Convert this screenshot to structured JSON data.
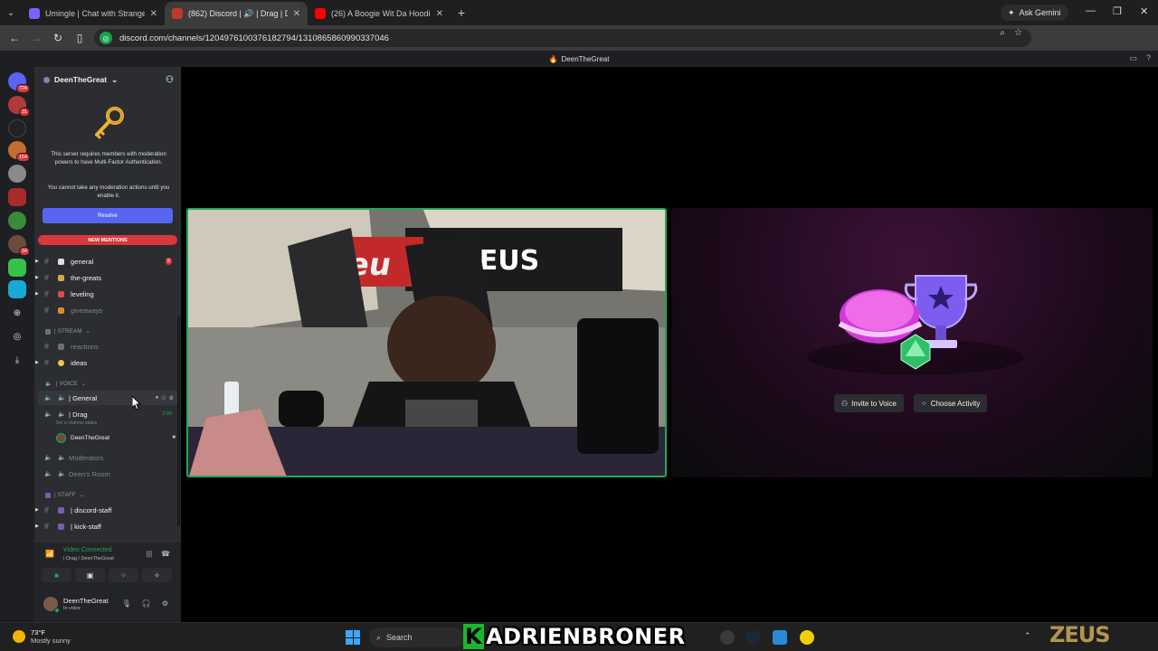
{
  "browser": {
    "tabs": [
      {
        "title": "Umingle | Chat with Strangers N",
        "color": "#5865f2",
        "active": false
      },
      {
        "title": "(862) Discord | 🔊 | Drag | D",
        "color": "#c0392b",
        "active": true
      },
      {
        "title": "(26) A Boogie Wit Da Hoodie -",
        "color": "#ff0000",
        "active": false
      }
    ],
    "ask_gemini": "Ask Gemini",
    "url": "discord.com/channels/1204976100376182794/1310865860990337046"
  },
  "discord": {
    "window_title": "DeenTheGreat",
    "server_name": "DeenTheGreat",
    "rail_badges": [
      "724",
      "31",
      "154",
      "34"
    ],
    "mfa": {
      "line1": "This server requires members with moderation powers to have Multi-Factor Authentication.",
      "line2": "You cannot take any moderation actions until you enable it.",
      "resolve": "Resolve"
    },
    "new_mentions": "NEW MENTIONS",
    "channels_top": [
      {
        "name": "general",
        "count": "5",
        "muted": false,
        "emoji_color": "#e0e0e0"
      },
      {
        "name": "the-greats",
        "muted": false,
        "emoji_color": "#d9a54a"
      },
      {
        "name": "leveling",
        "muted": false,
        "emoji_color": "#e04848"
      },
      {
        "name": "giveaways",
        "muted": true,
        "emoji_color": "#e08a2b"
      }
    ],
    "cat_stream": "| STREAM",
    "stream_channels": [
      {
        "name": "reactions",
        "muted": true,
        "emoji_color": "#6d6f78"
      },
      {
        "name": "ideas",
        "muted": false,
        "emoji_color": "#f5c542"
      }
    ],
    "cat_voice": "| VOICE",
    "voice_channels": [
      {
        "name": "| General",
        "muted": false
      },
      {
        "name": "| Drag",
        "muted": false,
        "time": "2:09"
      }
    ],
    "set_status": "Set a channel status",
    "member": "DeenTheGreat",
    "voice_channels_2": [
      {
        "name": "Moderators"
      },
      {
        "name": "Deen's Room"
      }
    ],
    "cat_staff": "| STAFF",
    "staff_channels": [
      {
        "name": "| discord-staff"
      },
      {
        "name": "| kick-staff"
      }
    ],
    "voice_panel": {
      "status": "Video Connected",
      "channel": "| Drag / DeenTheGreat"
    },
    "user": {
      "name": "DeenTheGreat",
      "status": "In voice"
    },
    "activity": {
      "invite": "Invite to Voice",
      "choose": "Choose Activity"
    }
  },
  "taskbar": {
    "temp": "73°F",
    "weather": "Mostly sunny",
    "search": "Search",
    "overlay_text": "ADRIENBRONER",
    "overlay_k": "K",
    "watermark": "ZEUS"
  }
}
